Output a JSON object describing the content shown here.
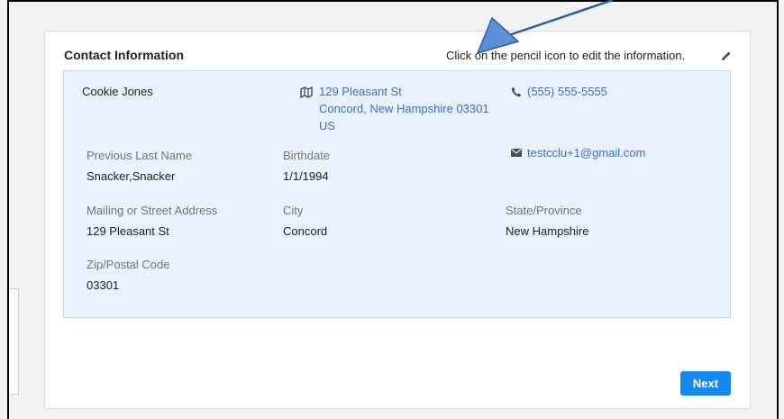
{
  "card": {
    "title": "Contact Information",
    "hint": "Click on the pencil icon to edit the information."
  },
  "contact": {
    "name": "Cookie Jones",
    "address_line1": "129 Pleasant St",
    "address_line2": "Concord, New Hampshire 03301",
    "address_line3": "US",
    "phone": "(555) 555-5555",
    "email": "testcclu+1@gmail.com"
  },
  "fields": {
    "previous_last_name": {
      "label": "Previous Last Name",
      "value": "Snacker,Snacker"
    },
    "birthdate": {
      "label": "Birthdate",
      "value": "1/1/1994"
    },
    "mailing_address": {
      "label": "Mailing or Street Address",
      "value": "129 Pleasant St"
    },
    "city": {
      "label": "City",
      "value": "Concord"
    },
    "state": {
      "label": "State/Province",
      "value": "New Hampshire"
    },
    "zip": {
      "label": "Zip/Postal Code",
      "value": "03301"
    }
  },
  "actions": {
    "next_label": "Next"
  },
  "icons": [
    "map-icon",
    "phone-icon",
    "mail-icon",
    "pencil-icon"
  ],
  "colors": {
    "link": "#3a6fd2",
    "button": "#1589ee",
    "panel": "#e9f1fc",
    "arrow": "#5b8fd6"
  }
}
